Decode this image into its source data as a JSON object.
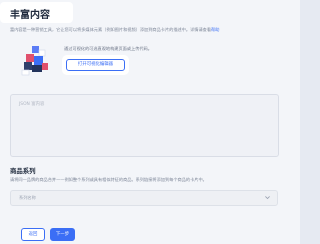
{
  "page": {
    "title": "丰富内容",
    "description_prefix": "富内容是一种营销工具，它让您可以将多媒体元素（例如图片和视频）添加到商品卡片的描述中。详情请查看",
    "description_link": "帮助",
    "visual_hint": "通过可视化的可选直观地构建页面或上传代码。",
    "visual_button": "打开可视化编辑器",
    "json_placeholder": "JSON 富内容",
    "series_title": "商品系列",
    "series_desc": "请将同一品牌的商品合并——例如整个系列或具有相似特征的商品。系列链接将添加到每个商品的卡片中。",
    "series_placeholder": "系列名称",
    "prev_label": "返回",
    "next_label": "下一步"
  },
  "colors": {
    "accent": "#3b6ef5",
    "title": "#1f2a3d",
    "muted": "#7c8597"
  },
  "icons": {
    "illustration": "puzzle-blocks-illustration",
    "select_arrow": "chevron-down-icon"
  }
}
